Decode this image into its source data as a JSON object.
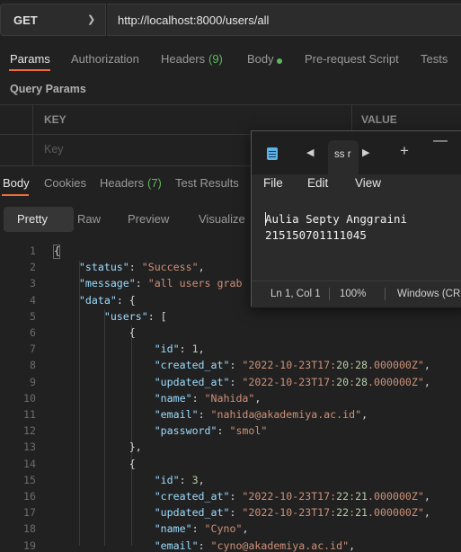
{
  "request": {
    "method": "GET",
    "url": "http://localhost:8000/users/all"
  },
  "request_tabs": {
    "params": "Params",
    "authorization": "Authorization",
    "headers": "Headers",
    "headers_count": "(9)",
    "body": "Body",
    "pre_request": "Pre-request Script",
    "tests": "Tests"
  },
  "query_params": {
    "title": "Query Params",
    "col_key": "KEY",
    "col_value": "VALUE",
    "key_placeholder": "Key"
  },
  "response_tabs": {
    "body": "Body",
    "cookies": "Cookies",
    "headers": "Headers",
    "headers_count": "(7)",
    "test_results": "Test Results"
  },
  "view_modes": {
    "pretty": "Pretty",
    "raw": "Raw",
    "preview": "Preview",
    "visualize": "Visualize"
  },
  "code": {
    "line_numbers": [
      "1",
      "2",
      "3",
      "4",
      "5",
      "6",
      "7",
      "8",
      "9",
      "10",
      "11",
      "12",
      "13",
      "14",
      "15",
      "16",
      "17",
      "18",
      "19"
    ],
    "lines": [
      {
        "t": "{"
      },
      {
        "t": "    \"status\": \"Success\","
      },
      {
        "t": "    \"message\": \"all users grab"
      },
      {
        "t": "    \"data\": {"
      },
      {
        "t": "        \"users\": ["
      },
      {
        "t": "            {"
      },
      {
        "t": "                \"id\": 1,"
      },
      {
        "t": "                \"created_at\": \"2022-10-23T17:20:28.000000Z\","
      },
      {
        "t": "                \"updated_at\": \"2022-10-23T17:20:28.000000Z\","
      },
      {
        "t": "                \"name\": \"Nahida\","
      },
      {
        "t": "                \"email\": \"nahida@akademiya.ac.id\","
      },
      {
        "t": "                \"password\": \"smol\""
      },
      {
        "t": "            },"
      },
      {
        "t": "            {"
      },
      {
        "t": "                \"id\": 3,"
      },
      {
        "t": "                \"created_at\": \"2022-10-23T17:22:21.000000Z\","
      },
      {
        "t": "                \"updated_at\": \"2022-10-23T17:22:21.000000Z\","
      },
      {
        "t": "                \"name\": \"Cyno\","
      },
      {
        "t": "                \"email\": \"cyno@akademiya.ac.id\","
      }
    ]
  },
  "notepad": {
    "tab_label": "ss r",
    "menu_file": "File",
    "menu_edit": "Edit",
    "menu_view": "View",
    "text": "Aulia Septy Anggraini\n215150701111045",
    "status_pos": "Ln 1, Col 1",
    "status_zoom": "100%",
    "status_eol": "Windows (CR"
  },
  "colors": {
    "accent": "#f26b3a",
    "green": "#5fb760",
    "json_key": "#9cdcfe",
    "json_string": "#ce9178",
    "json_number": "#b5cea8"
  }
}
